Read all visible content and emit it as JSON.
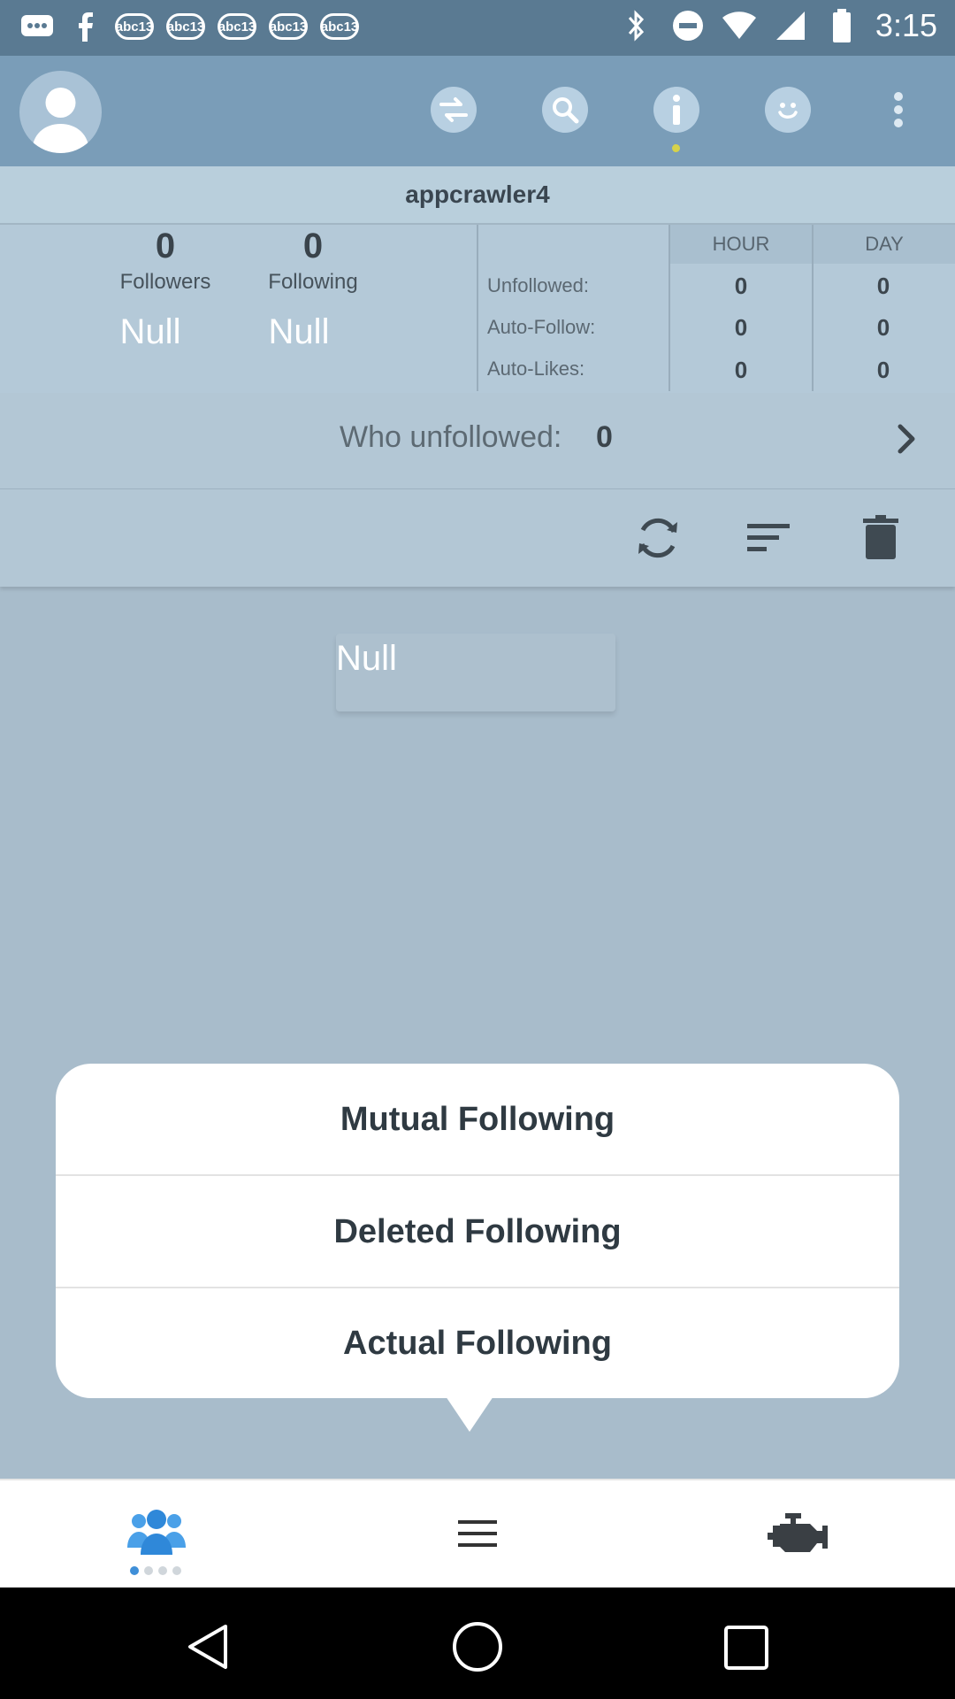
{
  "status_bar": {
    "time": "3:15",
    "chip_label": "abc13"
  },
  "header": {
    "username": "appcrawler4",
    "icons": [
      "avatar-icon",
      "swap-icon",
      "search-icon",
      "info-icon",
      "smiley-icon",
      "more-vert-icon"
    ]
  },
  "stats": {
    "followers": {
      "count": "0",
      "label": "Followers",
      "extra": "Null"
    },
    "following": {
      "count": "0",
      "label": "Following",
      "extra": "Null"
    },
    "table": {
      "col_hour": "HOUR",
      "col_day": "DAY",
      "rows": [
        {
          "label": "Unfollowed:",
          "hour": "0",
          "day": "0"
        },
        {
          "label": "Auto-Follow:",
          "hour": "0",
          "day": "0"
        },
        {
          "label": "Auto-Likes:",
          "hour": "0",
          "day": "0"
        }
      ]
    }
  },
  "who_unfollowed": {
    "label": "Who unfollowed:",
    "count": "0"
  },
  "list_placeholder": "Null",
  "popup": {
    "items": [
      "Mutual Following",
      "Deleted Following",
      "Actual Following"
    ]
  },
  "colors": {
    "header": "#7a9db8",
    "status_bar": "#5a7a92",
    "background": "#a8bccb",
    "accent_blue": "#3f8fd8",
    "accent_dot": "#d6d24a"
  }
}
